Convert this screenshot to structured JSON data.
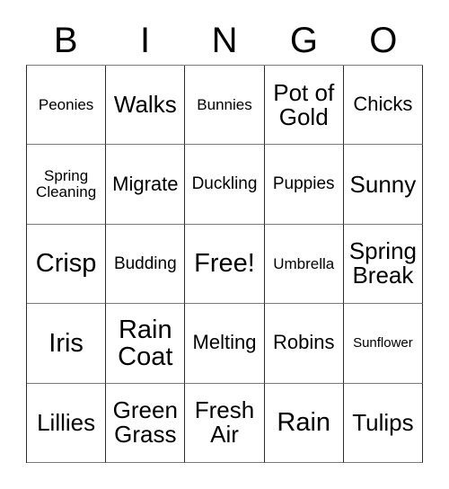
{
  "card": {
    "headers": [
      "B",
      "I",
      "N",
      "G",
      "O"
    ],
    "rows": [
      [
        {
          "label": "Peonies",
          "size": "sm"
        },
        {
          "label": "Walks",
          "size": "xl"
        },
        {
          "label": "Bunnies",
          "size": "sm"
        },
        {
          "label": "Pot of Gold",
          "size": "xl"
        },
        {
          "label": "Chicks",
          "size": "lg"
        }
      ],
      [
        {
          "label": "Spring Cleaning",
          "size": "sm"
        },
        {
          "label": "Migrate",
          "size": "lg"
        },
        {
          "label": "Duckling",
          "size": "md"
        },
        {
          "label": "Puppies",
          "size": "md"
        },
        {
          "label": "Sunny",
          "size": "xl"
        }
      ],
      [
        {
          "label": "Crisp",
          "size": "xxl"
        },
        {
          "label": "Budding",
          "size": "md"
        },
        {
          "label": "Free!",
          "size": "xxl"
        },
        {
          "label": "Umbrella",
          "size": "sm"
        },
        {
          "label": "Spring Break",
          "size": "xl"
        }
      ],
      [
        {
          "label": "Iris",
          "size": "xxl"
        },
        {
          "label": "Rain Coat",
          "size": "xxl"
        },
        {
          "label": "Melting",
          "size": "lg"
        },
        {
          "label": "Robins",
          "size": "lg"
        },
        {
          "label": "Sunflower",
          "size": "xs"
        }
      ],
      [
        {
          "label": "Lillies",
          "size": "xl"
        },
        {
          "label": "Green Grass",
          "size": "xl"
        },
        {
          "label": "Fresh Air",
          "size": "xl"
        },
        {
          "label": "Rain",
          "size": "xxl"
        },
        {
          "label": "Tulips",
          "size": "xl"
        }
      ]
    ]
  },
  "colors": {
    "background": "#ffffff",
    "text": "#000000",
    "border_dark": "#2b2b2b",
    "border_light": "#7a7a7a"
  }
}
